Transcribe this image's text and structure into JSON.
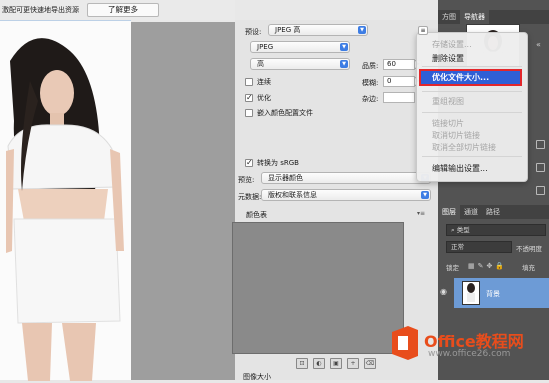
{
  "top_bar": {
    "info_text": "激配可更快速地导出资源",
    "learn_more": "了解更多"
  },
  "settings": {
    "preset_label": "预设:",
    "preset_value": "JPEG 高",
    "format_value": "JPEG",
    "quality_level": "高",
    "quality_label": "品质:",
    "quality_value": "60",
    "blur_label": "模糊:",
    "blur_value": "0",
    "matte_label": "杂边:",
    "progressive_label": "连续",
    "progressive_checked": false,
    "optimized_label": "优化",
    "optimized_checked": true,
    "embed_profile_label": "嵌入颜色配置文件",
    "embed_profile_checked": false,
    "convert_srgb_label": "转换为 sRGB",
    "convert_srgb_checked": true,
    "preview_label": "预览:",
    "preview_value": "显示器颜色",
    "metadata_label": "元数据:",
    "metadata_value": "版权和联系信息",
    "color_table_label": "颜色表",
    "image_size_label": "图像大小"
  },
  "menu": {
    "items": [
      {
        "label": "存储设置...",
        "enabled": false
      },
      {
        "label": "删除设置",
        "enabled": true
      },
      {
        "label": "优化文件大小...",
        "enabled": true,
        "highlighted": true
      },
      {
        "label": "重组视图",
        "enabled": false
      },
      {
        "label": "链接切片",
        "enabled": false
      },
      {
        "label": "取消切片链接",
        "enabled": false
      },
      {
        "label": "取消全部切片链接",
        "enabled": false
      },
      {
        "label": "编辑输出设置...",
        "enabled": true
      }
    ]
  },
  "right_panel": {
    "tabs": [
      "方图",
      "导航器"
    ],
    "layers_tabs": [
      "图层",
      "通道",
      "路径"
    ],
    "kind_filter": "类型",
    "blend_mode": "正常",
    "opacity_label": "不透明度",
    "lock_label": "锁定",
    "fill_label": "填充",
    "layer_name": "背景"
  },
  "watermark": {
    "brand": "Office教程网",
    "url": "www.office26.com"
  },
  "colors": {
    "accent": "#3d7de4",
    "highlight_border": "#e3262b",
    "dark_panel": "#535353"
  }
}
